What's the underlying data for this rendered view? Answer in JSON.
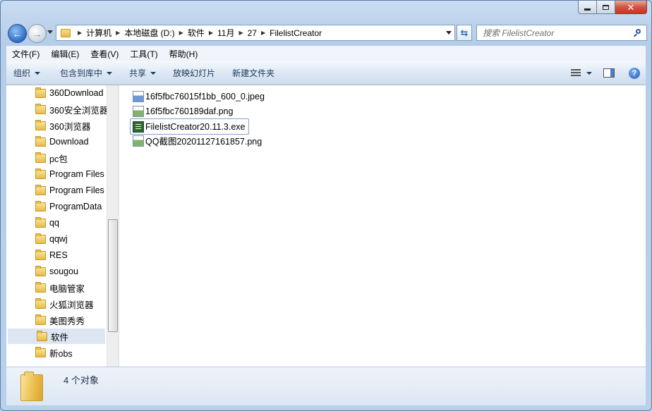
{
  "window": {
    "title": "FilelistCreator"
  },
  "nav": {
    "breadcrumbs": [
      "计算机",
      "本地磁盘 (D:)",
      "软件",
      "11月",
      "27",
      "FilelistCreator"
    ],
    "search_placeholder": "搜索 FilelistCreator"
  },
  "menu": [
    "文件(F)",
    "编辑(E)",
    "查看(V)",
    "工具(T)",
    "帮助(H)"
  ],
  "toolbar": {
    "organize": "组织",
    "include_library": "包含到库中",
    "share": "共享",
    "slideshow": "放映幻灯片",
    "new_folder": "新建文件夹"
  },
  "sidebar": {
    "items": [
      {
        "label": "360Download"
      },
      {
        "label": "360安全浏览器"
      },
      {
        "label": "360浏览器"
      },
      {
        "label": "Download"
      },
      {
        "label": "pc包"
      },
      {
        "label": "Program Files"
      },
      {
        "label": "Program Files"
      },
      {
        "label": "ProgramData"
      },
      {
        "label": "qq"
      },
      {
        "label": "qqwj"
      },
      {
        "label": "RES"
      },
      {
        "label": "sougou"
      },
      {
        "label": "电脑管家"
      },
      {
        "label": "火狐浏览器"
      },
      {
        "label": "美图秀秀"
      },
      {
        "label": "软件",
        "selected": true
      },
      {
        "label": "新obs"
      }
    ]
  },
  "files": [
    {
      "name": "16f5fbc76015f1bb_600_0.jpeg",
      "type": "jpeg-icon"
    },
    {
      "name": "16f5fbc760189daf.png",
      "type": "png-icon"
    },
    {
      "name": "FilelistCreator20.11.3.exe",
      "type": "exe-icon",
      "focused": true
    },
    {
      "name": "QQ截图20201127161857.png",
      "type": "png-icon"
    }
  ],
  "details": {
    "status": "4 个对象"
  }
}
